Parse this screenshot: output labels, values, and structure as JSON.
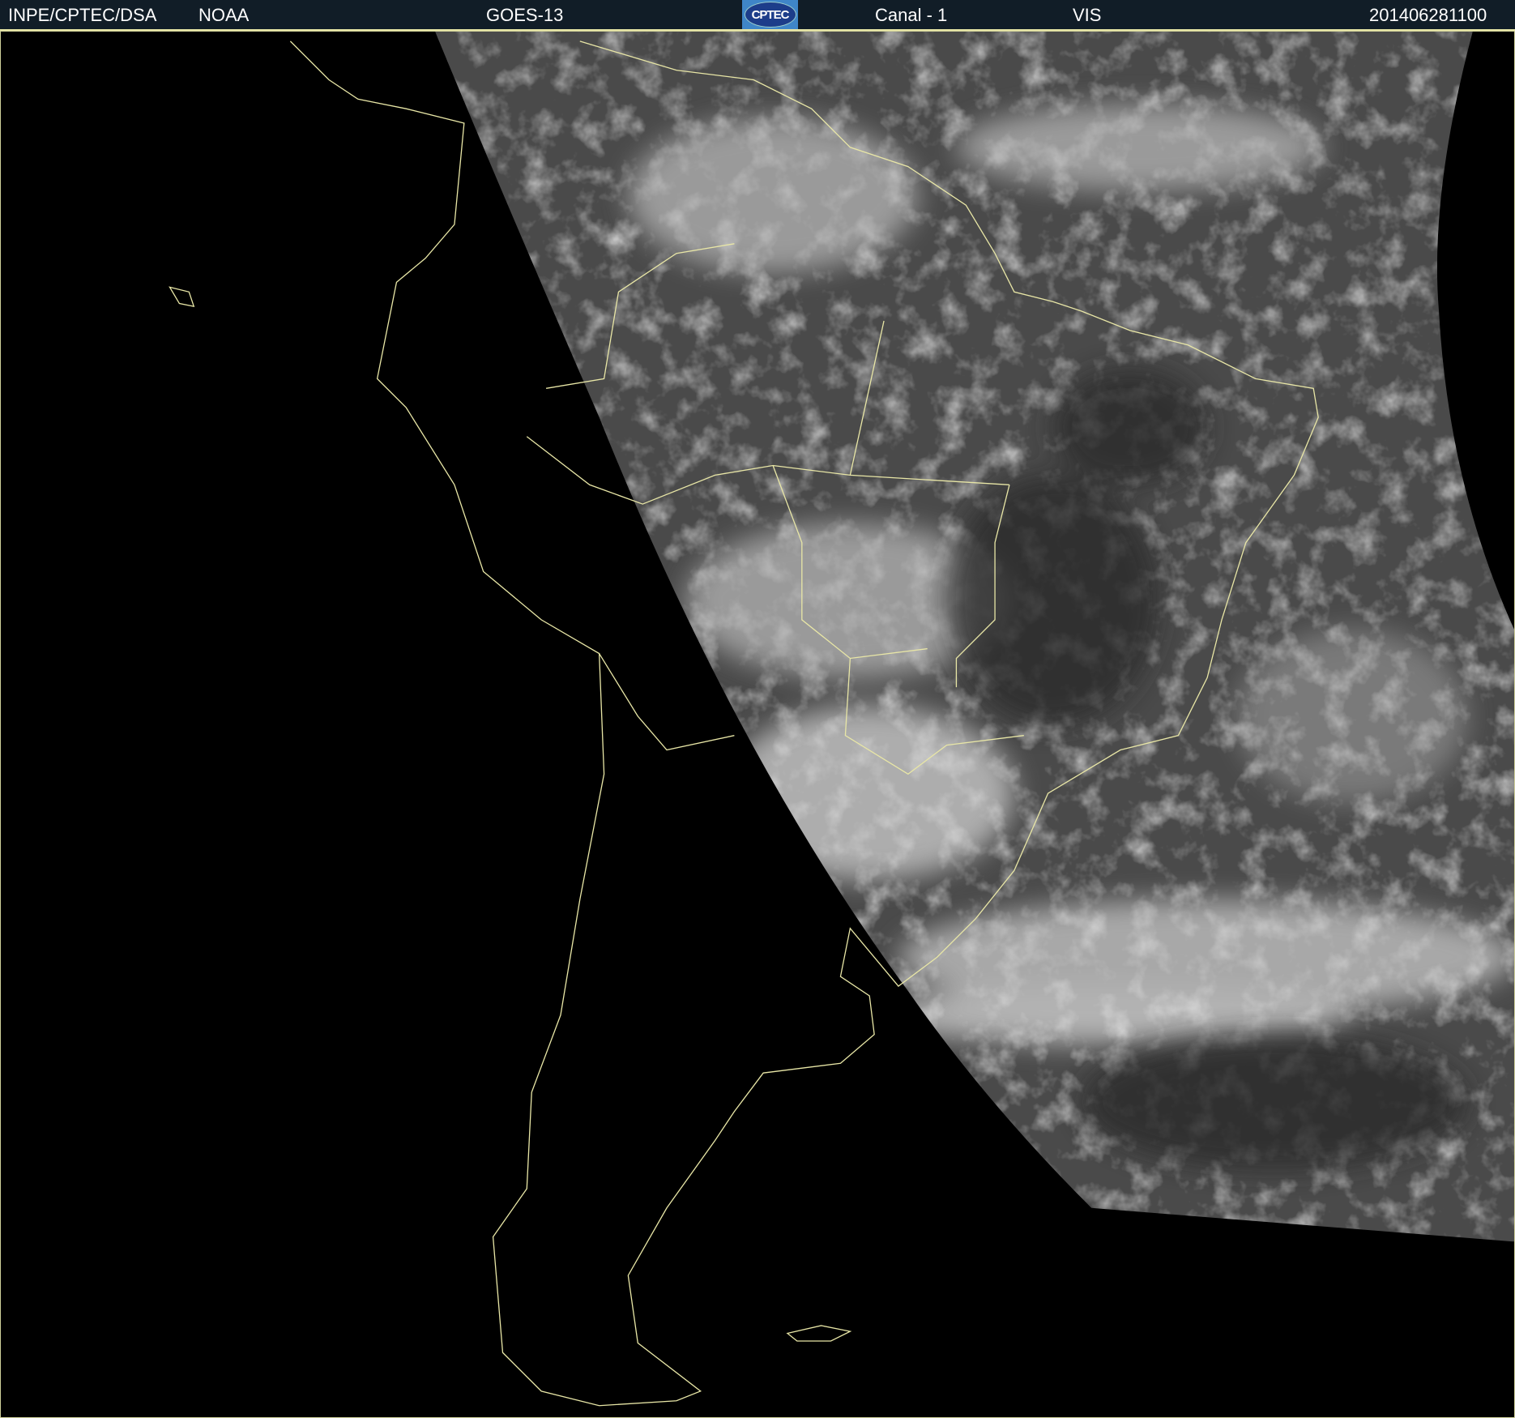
{
  "header": {
    "institution": "INPE/CPTEC/DSA",
    "agency": "NOAA",
    "satellite": "GOES-13",
    "logo_text": "CPTEC",
    "channel": "Canal - 1",
    "band": "VIS",
    "timestamp": "201406281100"
  },
  "colors": {
    "header_bg": "#111d27",
    "coastline": "#e8e6a6",
    "background": "#000000"
  }
}
